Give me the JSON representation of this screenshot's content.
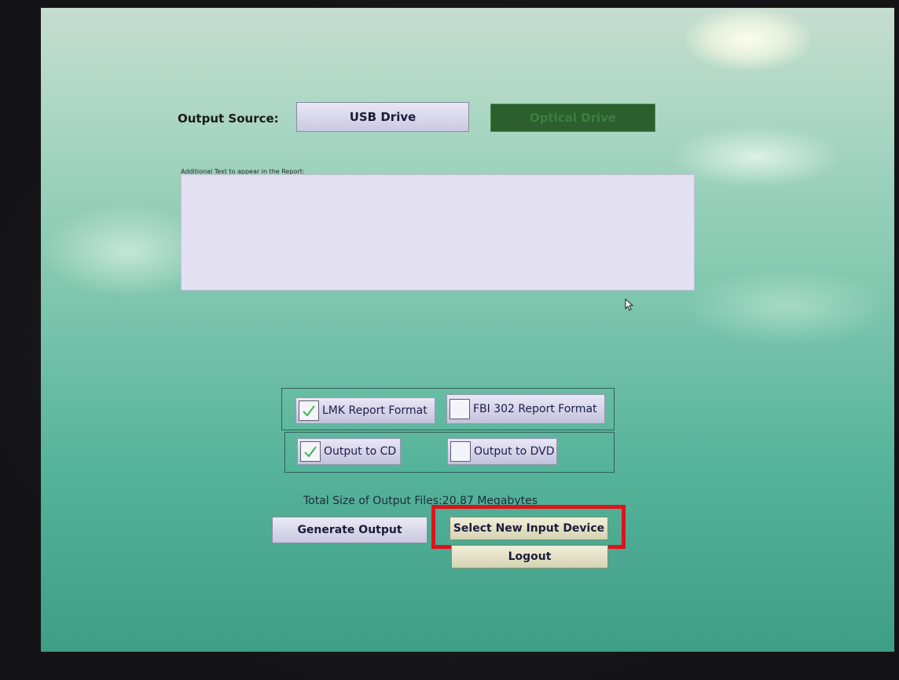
{
  "output_source": {
    "label": "Output Source:",
    "usb_button": "USB Drive",
    "optical_button": "Optical Drive"
  },
  "report": {
    "label": "Additional Text to appear in the Report:",
    "value": ""
  },
  "formats": {
    "lmk": {
      "label": "LMK Report Format",
      "checked": true
    },
    "fbi": {
      "label": "FBI 302 Report Format",
      "checked": false
    }
  },
  "media": {
    "cd": {
      "label": "Output to CD",
      "checked": true
    },
    "dvd": {
      "label": "Output to DVD",
      "checked": false
    }
  },
  "total_size": "Total Size of Output Files:20.87 Megabytes",
  "actions": {
    "generate": "Generate Output",
    "select_device": "Select New Input Device",
    "logout": "Logout"
  },
  "colors": {
    "highlight": "#e0121a",
    "check": "#3cb84a",
    "optical_bg": "#2c5e2e"
  },
  "icons": {
    "checkmark": "checkmark-icon",
    "cursor": "mouse-pointer-icon"
  }
}
